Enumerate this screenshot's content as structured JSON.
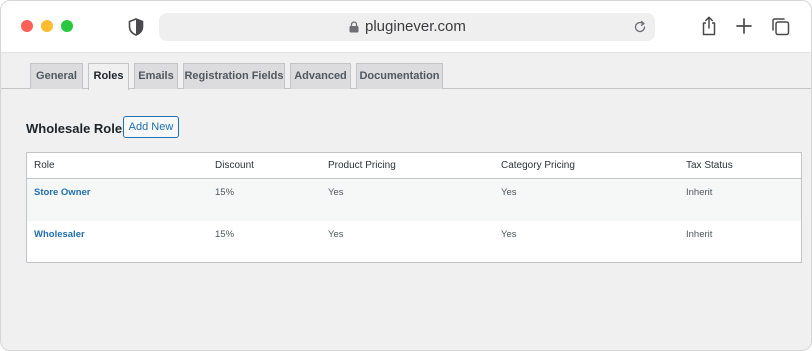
{
  "browser": {
    "url": "pluginever.com"
  },
  "tabs": [
    {
      "label": "General",
      "active": false
    },
    {
      "label": "Roles",
      "active": true
    },
    {
      "label": "Emails",
      "active": false
    },
    {
      "label": "Registration Fields",
      "active": false
    },
    {
      "label": "Advanced",
      "active": false
    },
    {
      "label": "Documentation",
      "active": false
    }
  ],
  "section": {
    "title": "Wholesale Roles",
    "add_new_label": "Add New"
  },
  "table": {
    "columns": [
      "Role",
      "Discount",
      "Product Pricing",
      "Category Pricing",
      "Tax Status"
    ],
    "rows": [
      {
        "role": "Store Owner",
        "discount": "15%",
        "product_pricing": "Yes",
        "category_pricing": "Yes",
        "tax_status": "Inherit"
      },
      {
        "role": "Wholesaler",
        "discount": "15%",
        "product_pricing": "Yes",
        "category_pricing": "Yes",
        "tax_status": "Inherit"
      }
    ]
  },
  "colors": {
    "accent": "#2271b1",
    "close": "#fe5f57",
    "minimize": "#febc2e",
    "maximize": "#28c840"
  },
  "icons": [
    "shield-icon",
    "lock-icon",
    "reload-icon",
    "share-icon",
    "plus-icon",
    "tabs-icon"
  ]
}
